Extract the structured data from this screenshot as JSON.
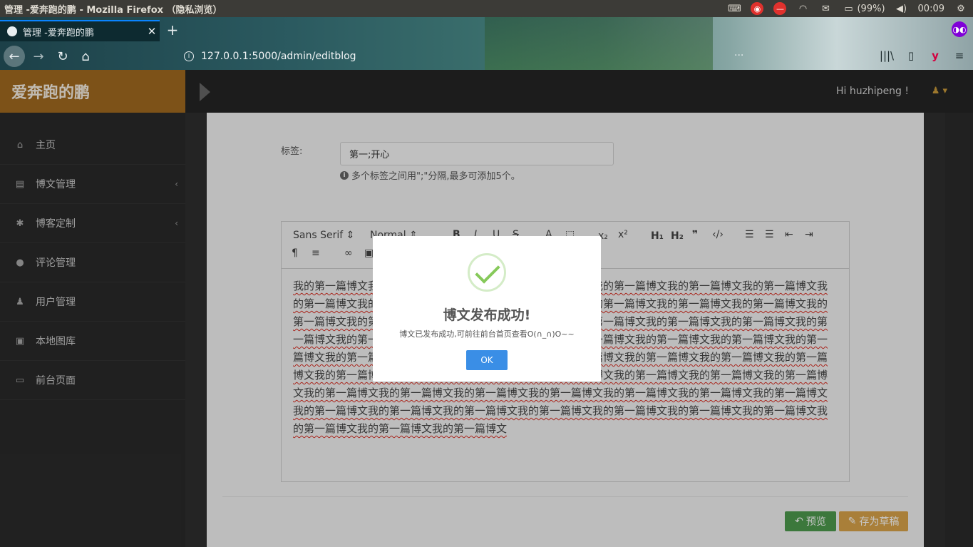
{
  "os": {
    "window_title": "管理 -爱奔跑的鹏 - Mozilla Firefox （隐私浏览）",
    "battery": "(99%)",
    "time": "00:09"
  },
  "browser": {
    "tab_title": "管理 -爱奔跑的鹏",
    "url": "127.0.0.1:5000/admin/editblog",
    "page_actions": "···"
  },
  "sidebar": {
    "brand": "爱奔跑的鹏",
    "items": [
      {
        "label": "主页",
        "icon": "home-icon",
        "glyph": "⌂"
      },
      {
        "label": "博文管理",
        "icon": "book-icon",
        "glyph": "▤",
        "arrow": "‹"
      },
      {
        "label": "博客定制",
        "icon": "gear-icon",
        "glyph": "✱",
        "arrow": "‹"
      },
      {
        "label": "评论管理",
        "icon": "comments-icon",
        "glyph": "●"
      },
      {
        "label": "用户管理",
        "icon": "user-icon",
        "glyph": "♟"
      },
      {
        "label": "本地图库",
        "icon": "image-icon",
        "glyph": "▣"
      },
      {
        "label": "前台页面",
        "icon": "desktop-icon",
        "glyph": "▭"
      }
    ]
  },
  "topnav": {
    "greeting": "Hi huzhipeng !"
  },
  "form": {
    "tag_label": "标签:",
    "tag_value": "第一;开心",
    "tag_help": "多个标签之间用\";\"分隔,最多可添加5个。"
  },
  "editor": {
    "font": "Sans Serif",
    "size": "Normal",
    "content": "我的第一篇博文我的第一篇博文我的第一篇博文我的第一篇博文我的第一篇博文我的第一篇博文我的第一篇博文我的第一篇博文我的第一篇博文我的第一篇博文我的第一篇博文我的第一篇博文我的第一篇博文我的第一篇博文我的第一篇博文我的第一篇博文我的第一篇博文我的第一篇博文我的第一篇博文我的第一篇博文我的第一篇博文我的第一篇博文我的第一篇博文我的第一篇博文我的第一篇博文我的第一篇博文我的第一篇博文我的第一篇博文我的第一篇博文我的第一篇博文我的第一篇博文我的第一篇博文我的第一篇博文我的第一篇博文我的第一篇博文我的第一篇博文我的第一篇博文我的第一篇博文我的第一篇博文我的第一篇博文我的第一篇博文我的第一篇博文我的第一篇博文我的第一篇博文我的第一篇博文我的第一篇博文我的第一篇博文我的第一篇博文我的第一篇博文我的第一篇博文我的第一篇博文我的第一篇博文我的第一篇博文我的第一篇博文我的第一篇博文我的第一篇博文我的第一篇博文我的第一篇博文我的第一篇博文我的第一篇博文"
  },
  "buttons": {
    "preview": "预览",
    "draft": "存为草稿"
  },
  "modal": {
    "title": "博文发布成功!",
    "text": "博文已发布成功,可前往前台首页查看O(∩_∩)O~~",
    "ok": "OK"
  }
}
